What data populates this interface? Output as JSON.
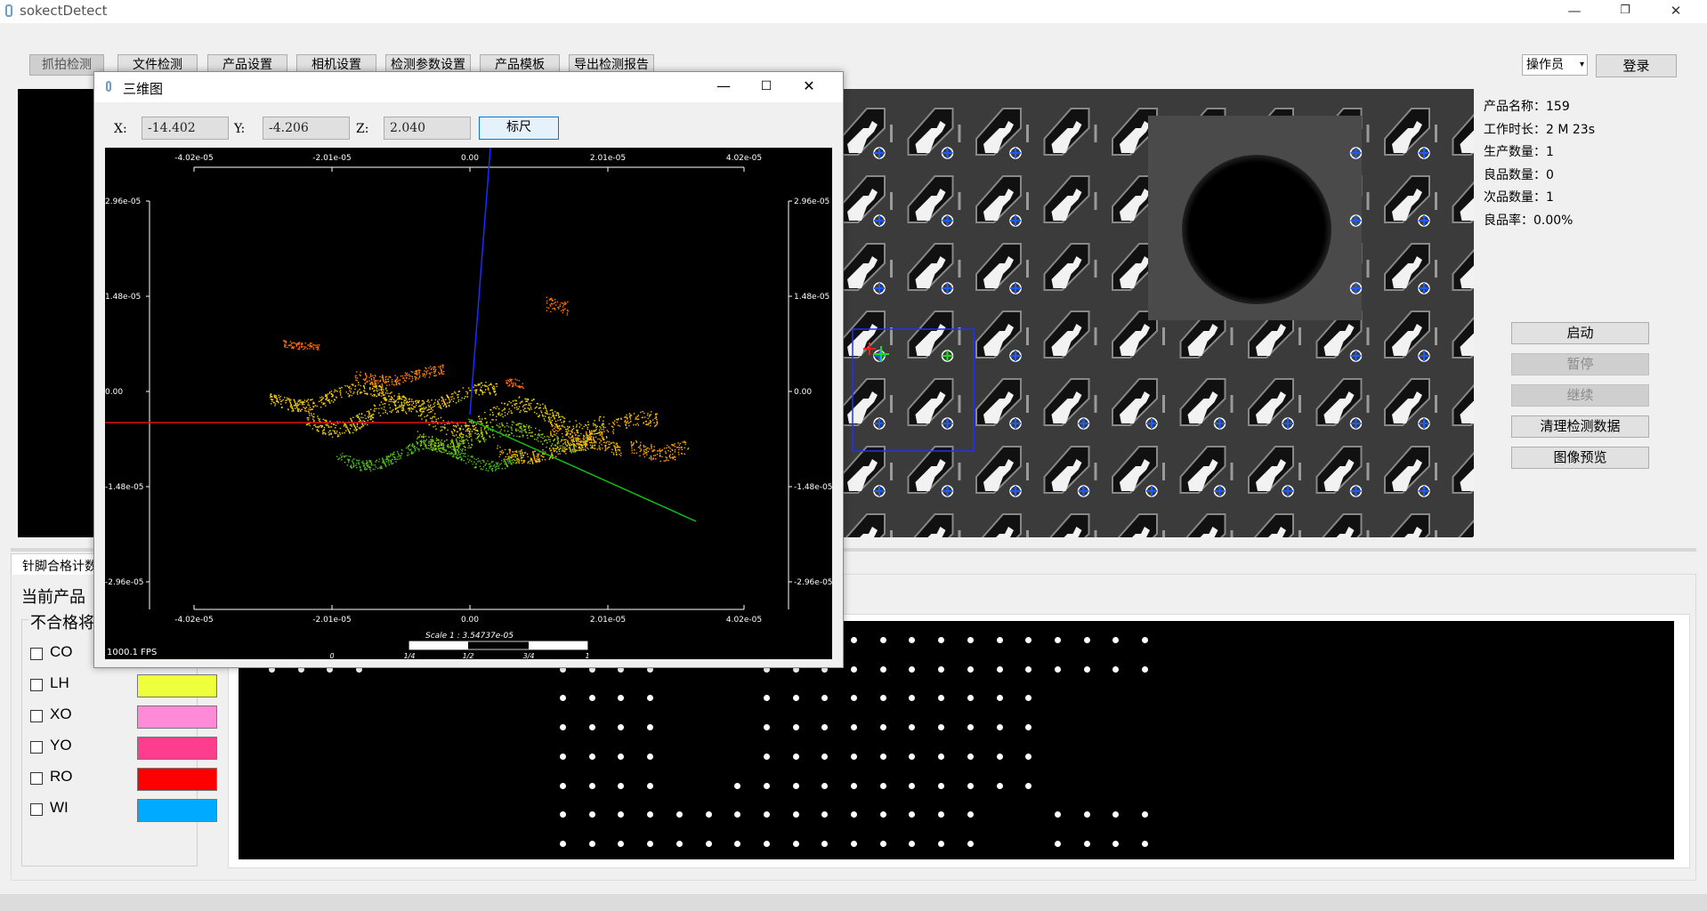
{
  "app": {
    "title": "sokectDetect"
  },
  "window_controls": {
    "minimize": "—",
    "restore": "❐",
    "close": "✕"
  },
  "toolbar": {
    "buttons": [
      "抓拍检测",
      "文件检测",
      "产品设置",
      "相机设置",
      "检测参数设置",
      "产品模板",
      "导出检测报告"
    ],
    "active_index": 0
  },
  "role_select": {
    "value": "操作员",
    "arrow": "▾"
  },
  "login": {
    "label": "登录"
  },
  "info": {
    "product_name": "产品名称：159",
    "work_time": "工作时长：2 M 23s",
    "production_count": "生产数量：1",
    "good_count": "良品数量：0",
    "defect_count": "次品数量：1",
    "yield_rate": "良品率：0.00%"
  },
  "controls": {
    "start": "启动",
    "pause": "暂停",
    "resume": "继续",
    "clear": "清理检测数据",
    "preview": "图像预览"
  },
  "bottom": {
    "tab": "针脚合格计数",
    "current_product": "当前产品",
    "group_title": "不合格将",
    "legend": [
      {
        "label": "CO",
        "color": "#f0f0f0"
      },
      {
        "label": "LH",
        "color": "#eeff3c"
      },
      {
        "label": "XO",
        "color": "#ff8ad8"
      },
      {
        "label": "YO",
        "color": "#ff3d8e"
      },
      {
        "label": "RO",
        "color": "#ff0000"
      },
      {
        "label": "WI",
        "color": "#00aaff"
      }
    ]
  },
  "dialog": {
    "title": "三维图",
    "x_label": "X:",
    "x_value": "-14.402",
    "y_label": "Y:",
    "y_value": "-4.206",
    "z_label": "Z:",
    "z_value": "2.040",
    "ruler_button": "标尺",
    "fps": "1000.1 FPS",
    "x_ticks": [
      "-4.02e-05",
      "-2.01e-05",
      "0.00",
      "2.01e-05",
      "4.02e-05"
    ],
    "y_ticks": [
      "2.96e-05",
      "1.48e-05",
      "0.00",
      "-1.48e-05",
      "-2.96e-05"
    ],
    "scale_text": "Scale 1 : 3.54737e-05",
    "scale_ticks": [
      "0",
      "1/4",
      "1/2",
      "3/4",
      "1"
    ]
  }
}
